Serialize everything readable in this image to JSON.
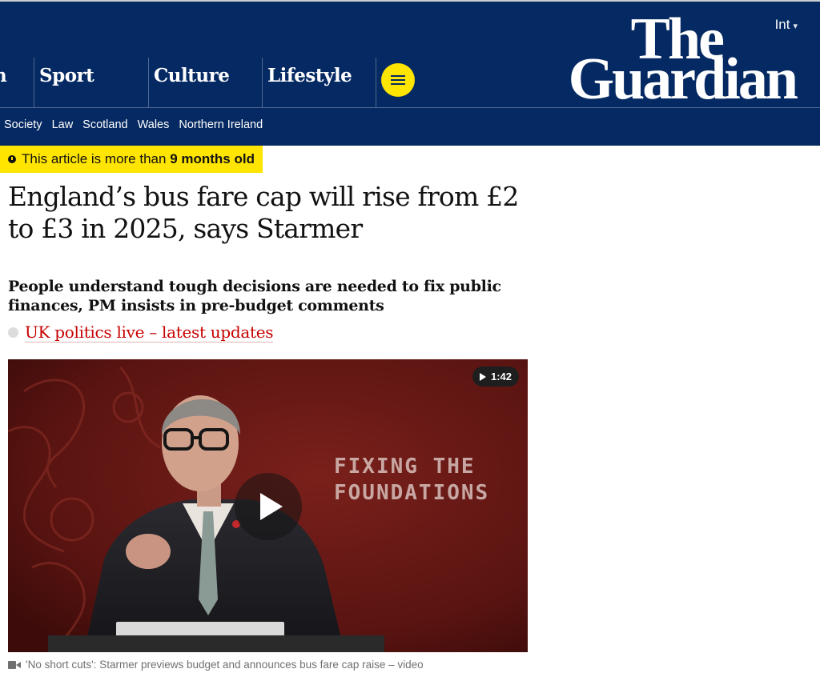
{
  "header": {
    "edition_label": "Int",
    "logo": {
      "line1": "The",
      "line2": "Guardian"
    },
    "pillars": [
      {
        "label": "n"
      },
      {
        "label": "Sport"
      },
      {
        "label": "Culture"
      },
      {
        "label": "Lifestyle"
      }
    ],
    "menu_icon": "hamburger-menu-icon",
    "subnav": [
      "Society",
      "Law",
      "Scotland",
      "Wales",
      "Northern Ireland"
    ]
  },
  "article": {
    "age_notice": {
      "prefix": "This article is more than ",
      "emphasis": "9 months old",
      "icon": "clock-icon"
    },
    "headline": "England’s bus fare cap will rise from £2 to £3 in 2025, says Starmer",
    "standfirst": "People understand tough decisions are needed to fix public finances, PM insists in pre-budget comments",
    "live_link": "UK politics live – latest updates",
    "video": {
      "duration": "1:42",
      "overlay_line1": "FIXING THE",
      "overlay_line2": "FOUNDATIONS",
      "caption": "'No short cuts': Starmer previews budget and announces bus fare cap raise – video"
    }
  },
  "colors": {
    "brand_navy": "#052962",
    "highlight_yellow": "#ffe500",
    "link_red": "#c70000"
  }
}
